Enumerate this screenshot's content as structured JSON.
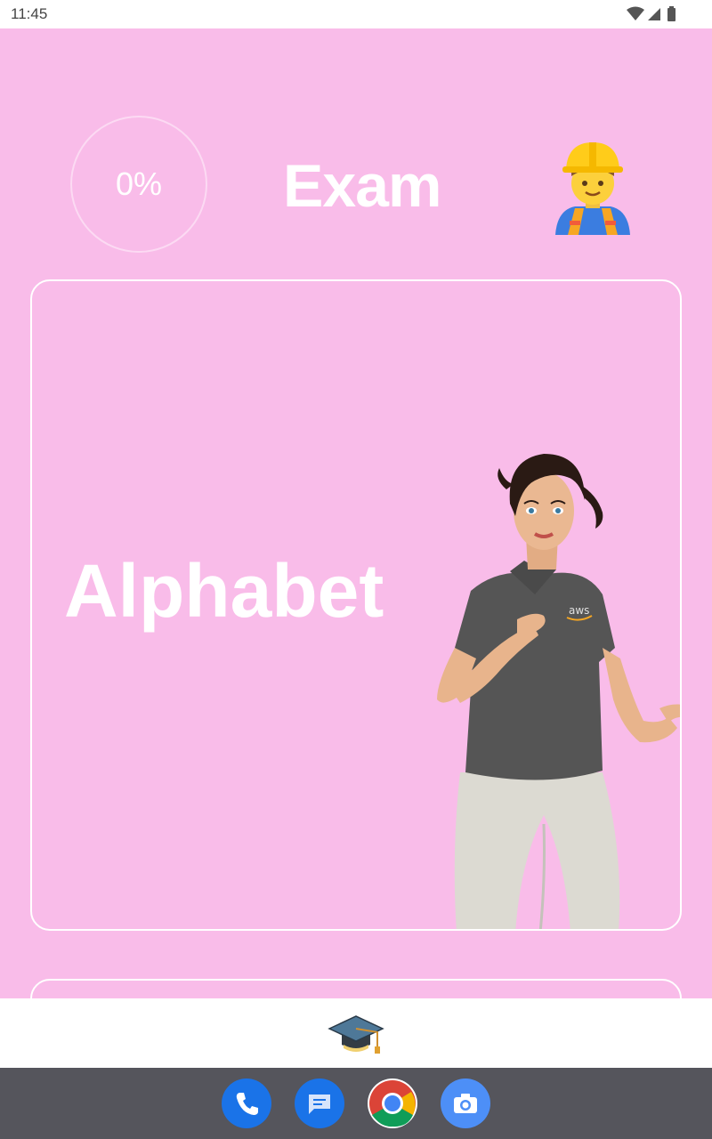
{
  "status_bar": {
    "time": "11:45"
  },
  "header": {
    "progress_text": "0%",
    "progress_value": 0,
    "title": "Exam",
    "avatar_icon": "construction-worker-emoji"
  },
  "card": {
    "title": "Alphabet",
    "avatar": "signing-avatar-woman"
  },
  "bottom_nav": {
    "icon": "graduation-cap-icon"
  },
  "dock": {
    "apps": [
      {
        "name": "phone-app-icon",
        "color": "#1a73e8"
      },
      {
        "name": "messages-app-icon",
        "color": "#1a73e8"
      },
      {
        "name": "chrome-app-icon",
        "color": "#ffffff"
      },
      {
        "name": "camera-app-icon",
        "color": "#4d8ff7"
      }
    ]
  },
  "colors": {
    "background": "#f9bce9",
    "accent_white": "#ffffff",
    "dock": "#55555c"
  }
}
